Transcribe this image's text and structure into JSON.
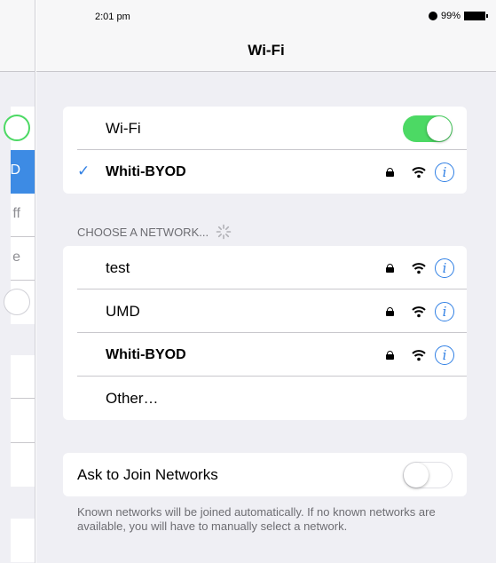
{
  "status": {
    "time": "2:01 pm",
    "battery": "99%"
  },
  "nav": {
    "title": "Wi-Fi"
  },
  "sidebar": {
    "partial_labels": [
      "D",
      "ff",
      "e"
    ]
  },
  "wifi_group": {
    "label": "Wi-Fi",
    "toggle_on": true,
    "connected_network": "Whiti-BYOD"
  },
  "network_list": {
    "header": "CHOOSE A NETWORK...",
    "networks": [
      {
        "name": "test",
        "bold": false
      },
      {
        "name": "UMD",
        "bold": false
      },
      {
        "name": "Whiti-BYOD",
        "bold": true
      }
    ],
    "other": "Other…"
  },
  "ask_join": {
    "label": "Ask to Join Networks",
    "toggle_on": false,
    "description": "Known networks will be joined automatically. If no known networks are available, you will have to manually select a network."
  },
  "colors": {
    "accent": "#2f7fe4",
    "toggle_on": "#4cd964",
    "group_bg": "#efeff4"
  }
}
